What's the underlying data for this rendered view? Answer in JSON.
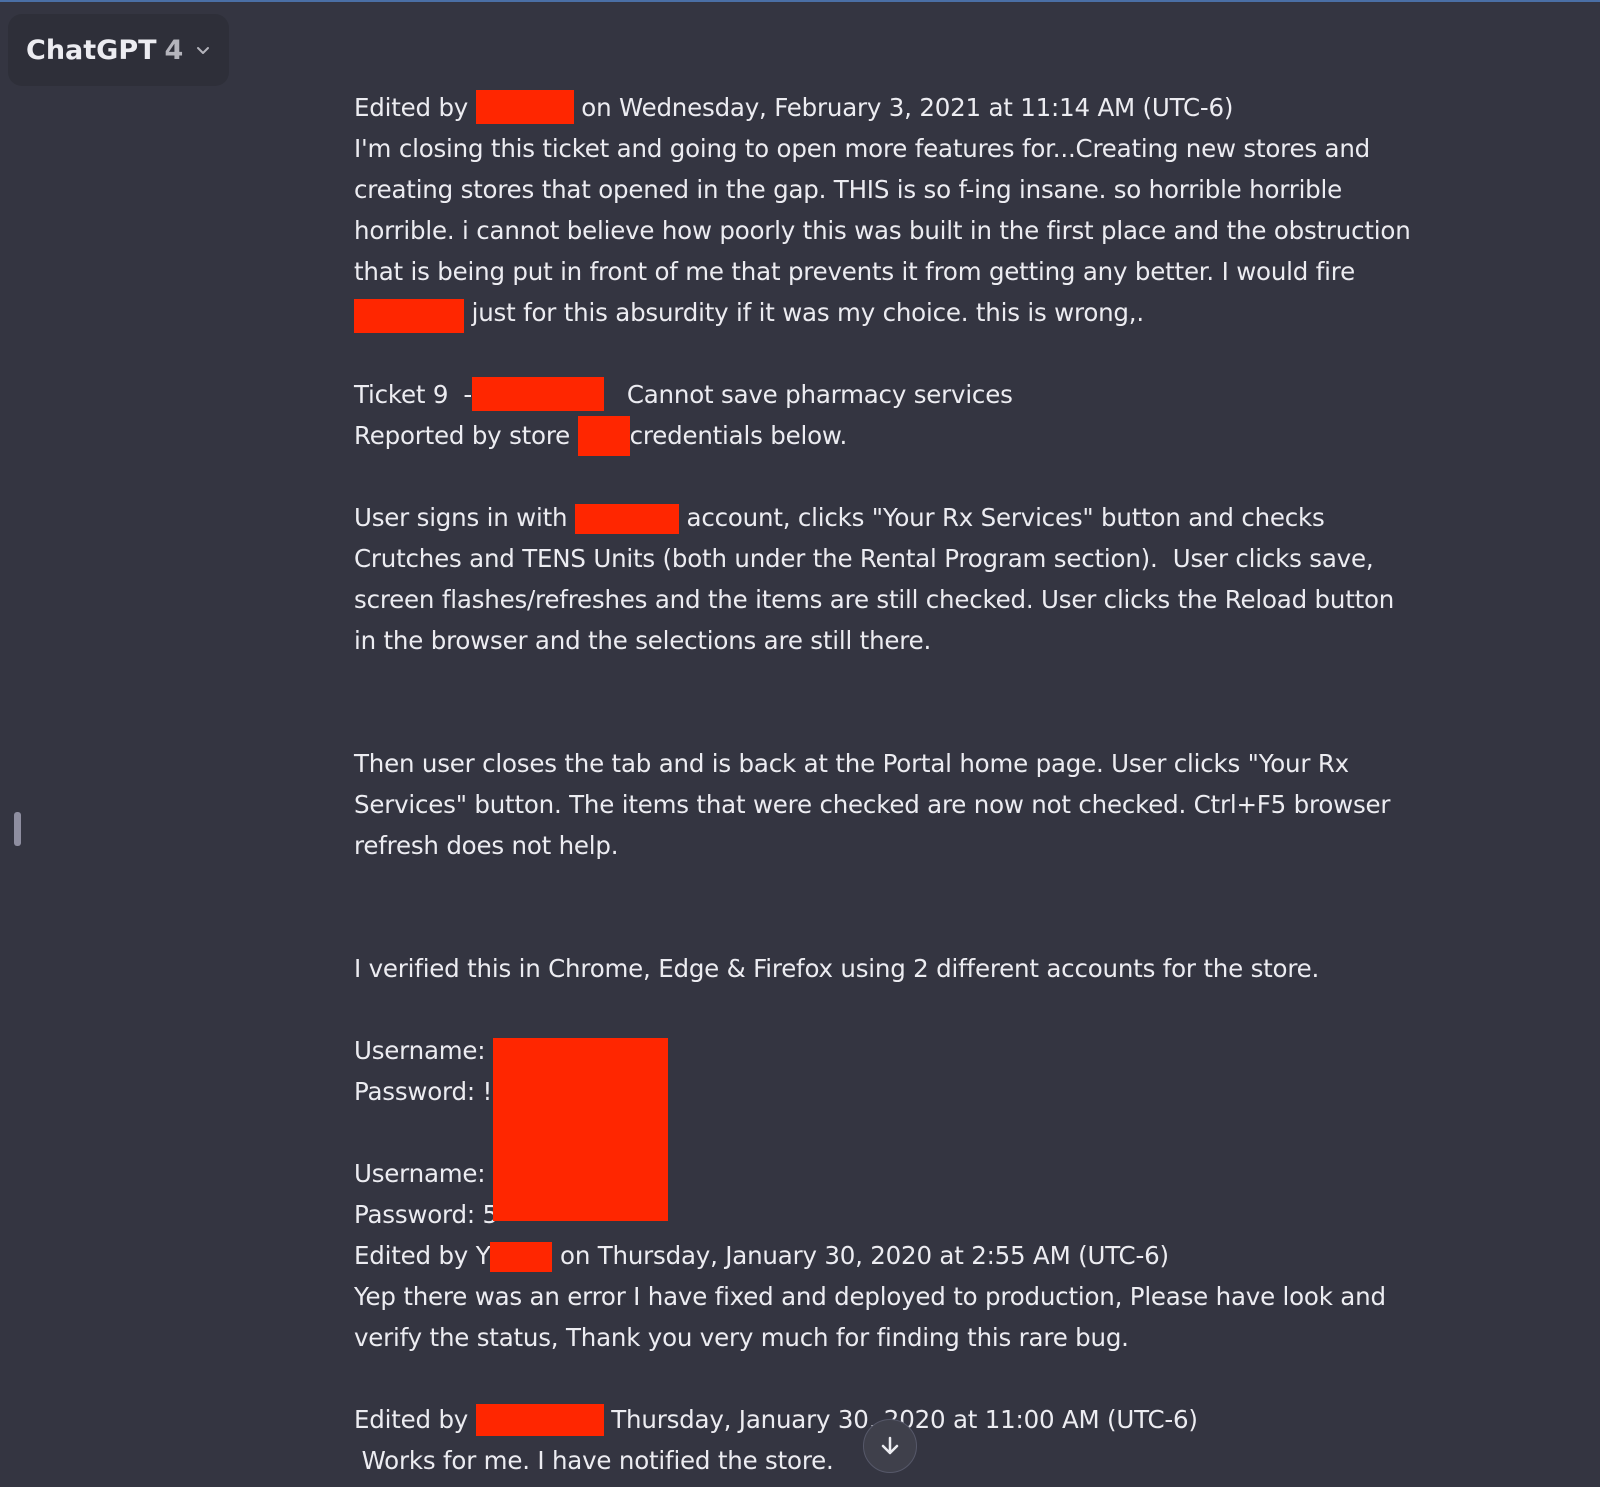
{
  "header": {
    "model_name": "ChatGPT",
    "model_version": "4"
  },
  "message": {
    "lines": [
      {
        "a": "Edited by ",
        "b": " on Wednesday, February 3, 2021 at 11:14 AM (UTC-6)"
      },
      {
        "a": "I'm closing this ticket and going to open more features for...Creating new stores and"
      },
      {
        "a": "creating stores that opened in the gap. THIS is so f-ing insane. so horrible horrible"
      },
      {
        "a": "horrible. i cannot believe how poorly this was built in the first place and the obstruction"
      },
      {
        "a": "that is being put in front of me that prevents it from getting any better. I would fire"
      },
      {
        "a": "",
        "b": " just for this absurdity if it was my choice. this is wrong,."
      },
      {
        "a": ""
      },
      {
        "a": "Ticket 9  -",
        "b": "   Cannot save pharmacy services"
      },
      {
        "a": "Reported by store ",
        "b": "credentials below."
      },
      {
        "a": ""
      },
      {
        "a": "User signs in with ",
        "b": " account, clicks \"Your Rx Services\" button and checks"
      },
      {
        "a": "Crutches and TENS Units (both under the Rental Program section).  User clicks save,"
      },
      {
        "a": "screen flashes/refreshes and the items are still checked. User clicks the Reload button"
      },
      {
        "a": "in the browser and the selections are still there."
      },
      {
        "a": ""
      },
      {
        "a": ""
      },
      {
        "a": "Then user closes the tab and is back at the Portal home page. User clicks \"Your Rx"
      },
      {
        "a": "Services\" button. The items that were checked are now not checked. Ctrl+F5 browser"
      },
      {
        "a": "refresh does not help."
      },
      {
        "a": ""
      },
      {
        "a": ""
      },
      {
        "a": "I verified this in Chrome, Edge & Firefox using 2 different accounts for the store."
      },
      {
        "a": ""
      },
      {
        "a": "Username: "
      },
      {
        "a": "Password: !"
      },
      {
        "a": ""
      },
      {
        "a": "Username: "
      },
      {
        "a": "Password: 5"
      },
      {
        "a": "Edited by Y",
        "b": " on Thursday, January 30, 2020 at 2:55 AM (UTC-6)"
      },
      {
        "a": "Yep there was an error I have fixed and deployed to production, Please have look and"
      },
      {
        "a": "verify the status, Thank you very much for finding this rare bug."
      },
      {
        "a": ""
      },
      {
        "a": "Edited by ",
        "b": " Thursday, January 30, 2020 at 11:00 AM (UTC-6)"
      },
      {
        "a": " Works for me. I have notified the store."
      }
    ]
  },
  "icons": {
    "chevron": "chevron-down-icon",
    "scroll_down": "arrow-down-icon"
  },
  "colors": {
    "background": "#343541",
    "text": "#ececf1",
    "redaction": "#ff2600"
  }
}
